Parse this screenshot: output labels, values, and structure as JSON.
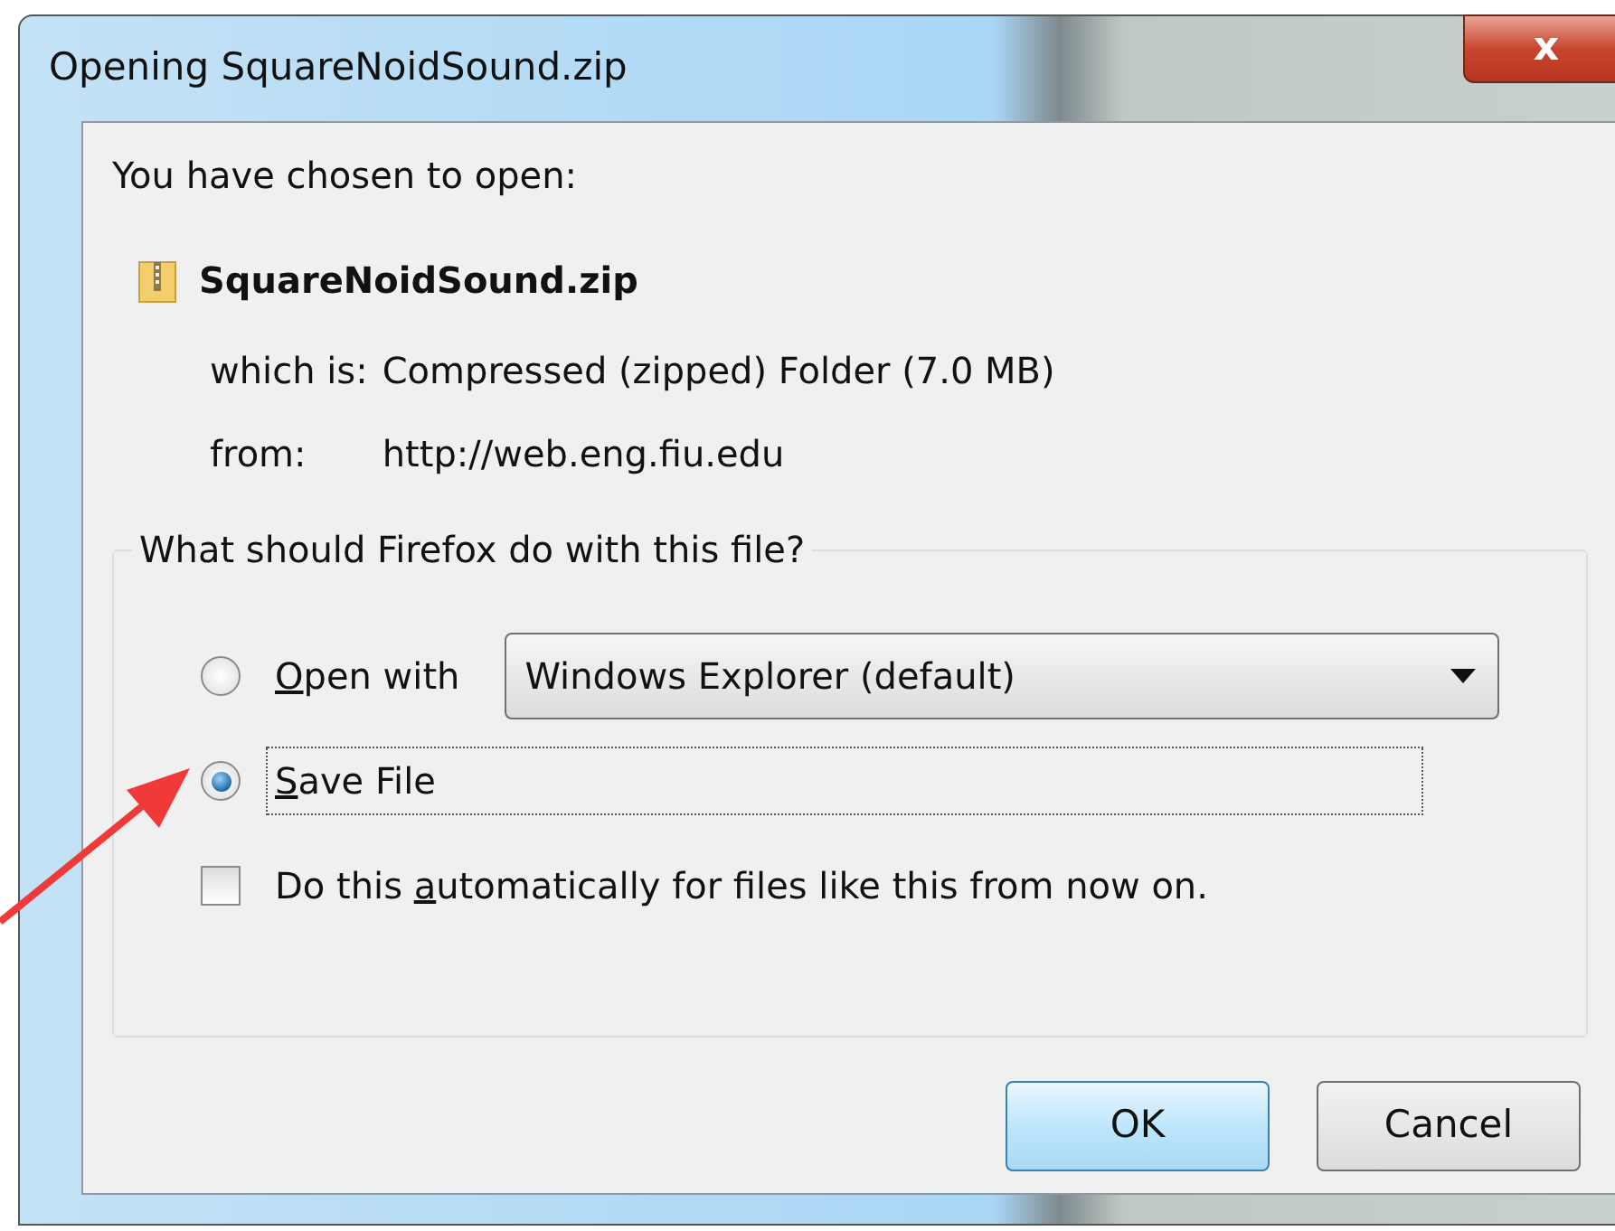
{
  "window": {
    "title": "Opening SquareNoidSound.zip",
    "close_label": "x"
  },
  "intro": "You have chosen to open:",
  "file": {
    "name": "SquareNoidSound.zip",
    "details": [
      {
        "label": "which is:",
        "value": "Compressed (zipped) Folder (7.0 MB)"
      },
      {
        "label": "from:",
        "value": "http://web.eng.fiu.edu"
      }
    ]
  },
  "group": {
    "legend": "What should Firefox do with this file?",
    "options": [
      {
        "kind": "radio",
        "access_key": "O",
        "key_after": "pen with",
        "selected": false,
        "focused": false,
        "dropdown": {
          "value": "Windows Explorer (default)"
        }
      },
      {
        "kind": "radio",
        "access_key": "S",
        "key_after": "ave File",
        "selected": true,
        "focused": true
      }
    ],
    "checkbox": {
      "key_before": "Do this ",
      "access_key": "a",
      "key_after": "utomatically for files like this from now on.",
      "checked": false
    }
  },
  "buttons": [
    {
      "label": "OK",
      "default": true
    },
    {
      "label": "Cancel",
      "default": false
    }
  ]
}
